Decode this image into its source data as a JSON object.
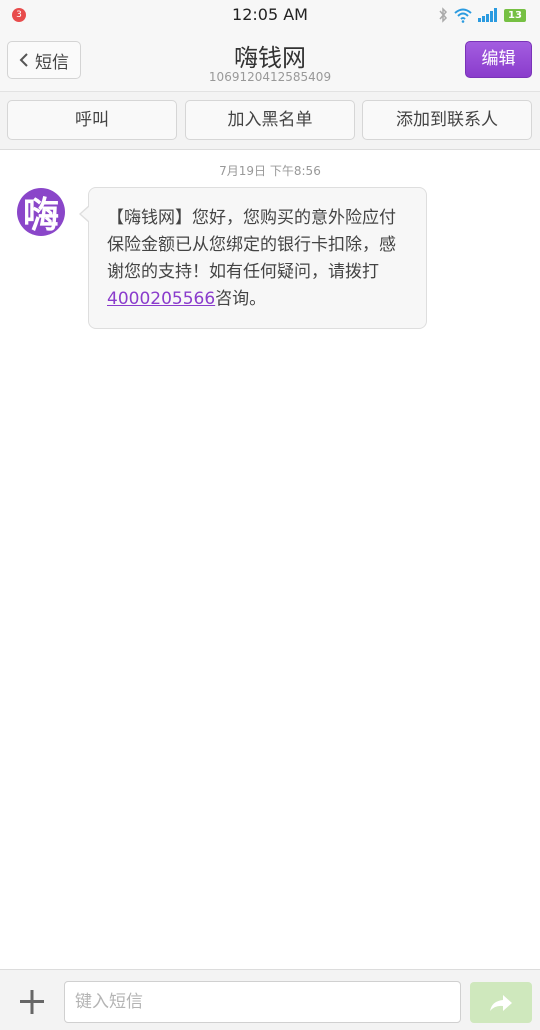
{
  "status_bar": {
    "notification_count": "3",
    "time": "12:05 AM",
    "battery": "13",
    "icons": [
      "bluetooth-icon",
      "wifi-icon",
      "signal-icon",
      "battery-icon"
    ]
  },
  "header": {
    "back_label": "短信",
    "title": "嗨钱网",
    "subtitle": "1069120412585409",
    "edit_label": "编辑"
  },
  "actions": {
    "call": "呼叫",
    "blacklist": "加入黑名单",
    "add_contact": "添加到联系人"
  },
  "conversation": {
    "timestamp": "7月19日 下午8:56",
    "avatar_text": "嗨",
    "message_before": "【嗨钱网】您好，您购买的意外险应付保险金额已从您绑定的银行卡扣除，感谢您的支持！如有任何疑问，请拨打",
    "message_phone": "4000205566",
    "message_after": "咨询。"
  },
  "composer": {
    "placeholder": "键入短信"
  },
  "colors": {
    "accent": "#8a3ccc",
    "send_button": "#cfe8bd",
    "notification_badge": "#e84c4c",
    "battery": "#76c043"
  }
}
